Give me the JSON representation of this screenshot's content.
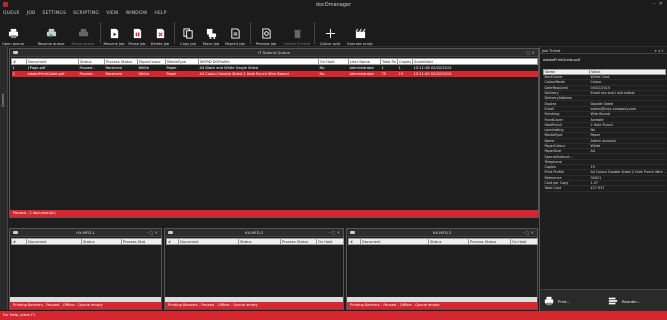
{
  "app": {
    "title": "docOmanager"
  },
  "menu": [
    "QUEUE",
    "JOB",
    "SETTINGS",
    "SCRIPTING",
    "VIEW",
    "WINDOW",
    "HELP"
  ],
  "toolbar": [
    {
      "label": "Open queue",
      "icon": "printer-icon",
      "enabled": true
    },
    {
      "label": "Resume queue",
      "icon": "printer-resume-icon",
      "enabled": true
    },
    {
      "label": "Pause queue",
      "icon": "printer-pause-icon",
      "enabled": false
    },
    {
      "label": "Resume job",
      "icon": "resume-job-icon",
      "enabled": true
    },
    {
      "label": "Pause job",
      "icon": "pause-job-icon",
      "enabled": true
    },
    {
      "label": "Delete job",
      "icon": "delete-job-icon",
      "enabled": true
    },
    {
      "label": "Copy job",
      "icon": "copy-job-icon",
      "enabled": true
    },
    {
      "label": "Move job",
      "icon": "move-job-icon",
      "enabled": true
    },
    {
      "label": "Reprint job",
      "icon": "reprint-job-icon",
      "enabled": true
    },
    {
      "label": "Preview job",
      "icon": "preview-job-icon",
      "enabled": true
    },
    {
      "label": "Delete Printed",
      "icon": "trash-icon",
      "enabled": false
    },
    {
      "label": "Colour split",
      "icon": "colour-split-icon",
      "enabled": true
    },
    {
      "label": "Execute script",
      "icon": "execute-script-icon",
      "enabled": true
    }
  ],
  "sidebar": {
    "label": "Queues"
  },
  "queue": {
    "title": "IT Submit Queue",
    "columns": [
      "#",
      "Document",
      "Status",
      "Process Status",
      "PaperColour",
      "MediaType",
      "WORD DOProfile",
      "On Hold",
      "User Name",
      "Total Pa...",
      "Copies",
      "Submitted"
    ],
    "rows": [
      [
        "1",
        "1Page.pdf",
        "Paused -",
        "Received",
        "White",
        "Paper",
        "A4 Black and White Single Sided",
        "No",
        "Administrator",
        "1",
        "1",
        "13:11:38 02/02/2015"
      ],
      [
        "2",
        "adobePrintGuide.pdf",
        "Paused -",
        "Received",
        "White",
        "Paper",
        "A4 Colour Double Sided 2 Hole Punch Wire Bound",
        "No",
        "Administrator",
        "75",
        "19",
        "13:11:45 02/02/2015"
      ]
    ],
    "status": "Paused - 2 document(s)"
  },
  "mini_queues": [
    {
      "title": "HX-MFD-1",
      "columns": [
        "#",
        "Document",
        "Status",
        "Process Stat"
      ],
      "status": "Printing Banners - Paused - Offline - Queue empty"
    },
    {
      "title": "HX-MFD-2",
      "columns": [
        "#",
        "Document",
        "Status",
        "Process Status",
        "On Hold"
      ],
      "status": "Printing Banners - Paused - Offline - Queue empty"
    },
    {
      "title": "HX-MFD-3",
      "columns": [
        "#",
        "Document",
        "Status",
        "Process Status",
        "On Hold"
      ],
      "status": "Printing Banners - Paused - Offline - Queue empty"
    }
  ],
  "ticket": {
    "title": "Job Ticket",
    "file": "adobePrintGuide.pdf",
    "columns": [
      "Name",
      "Value"
    ],
    "rows": [
      [
        "BackCover",
        "White Card"
      ],
      [
        "ColourMode",
        "Colour"
      ],
      [
        "DateRequired",
        "04/02/2015"
      ],
      [
        "Delivery",
        "Email me and I will collect"
      ],
      [
        "DeliveryAddress",
        ""
      ],
      [
        "Duplex",
        "Double Sided"
      ],
      [
        "Email",
        "admin@myc.company.com"
      ],
      [
        "Finishing",
        "Wire Bound"
      ],
      [
        "FrontCover",
        "Acetate"
      ],
      [
        "HolePunch",
        "2 Hole Punch"
      ],
      [
        "Laminating",
        "No"
      ],
      [
        "MediaType",
        "Paper"
      ],
      [
        "Name",
        "Admin account"
      ],
      [
        "PaperColour",
        "White"
      ],
      [
        "PaperSize",
        "A4"
      ],
      [
        "SpecialInstruct...",
        ""
      ],
      [
        "Telephone",
        ""
      ],
      [
        "Copies",
        "19"
      ],
      [
        "Print Profile",
        "A4 Colour Double Sided 2 Hole Punch Wire ..."
      ],
      [
        "Reference",
        "00021"
      ],
      [
        "Cost per Copy",
        "1.47"
      ],
      [
        "Total Cost",
        "£27.937"
      ]
    ],
    "buttons": [
      {
        "label": "Print...",
        "icon": "print-icon"
      },
      {
        "label": "Reorder...",
        "icon": "reorder-icon"
      }
    ]
  },
  "status": "For Help, press F1",
  "colors": {
    "accent": "#d6262e",
    "background": "#1e1e1e"
  }
}
